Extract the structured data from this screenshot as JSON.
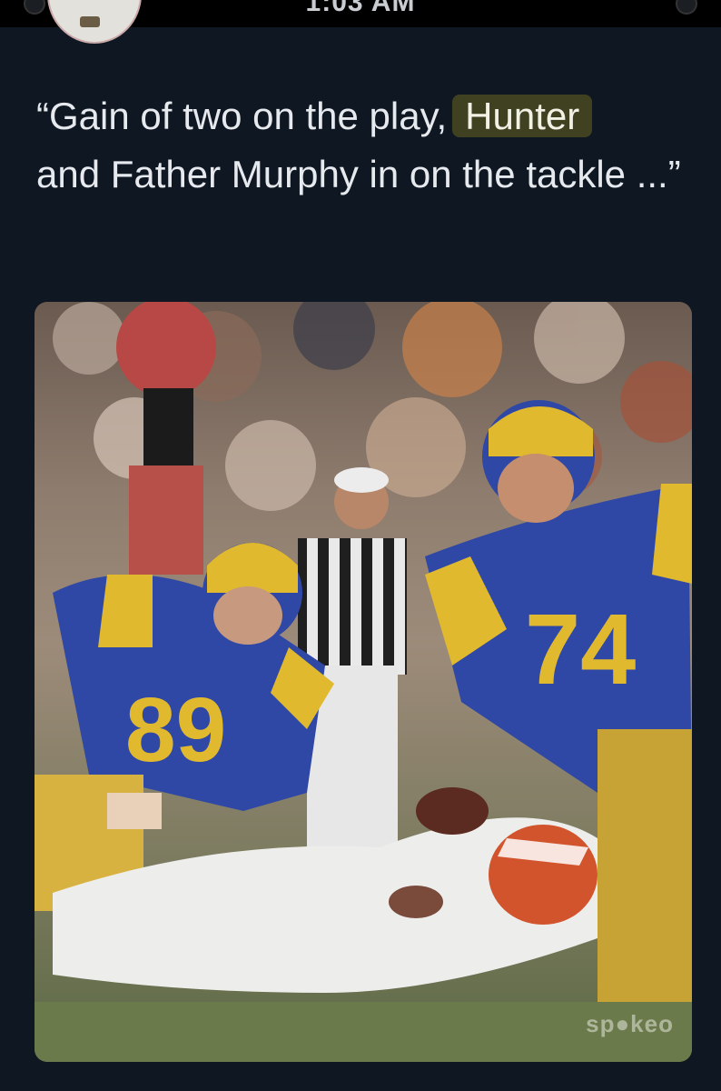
{
  "status_bar": {
    "time": "1:03 AM"
  },
  "tweet": {
    "text_before": "“Gain of two on the play,",
    "highlighted_word": "Hunter",
    "text_after": "and Father Murphy in on the tackle ...”"
  },
  "photo": {
    "jersey_numbers": [
      "89",
      "74",
      "89",
      "74"
    ],
    "watermark": "sp●keo",
    "colors": {
      "rams_blue": "#2f48a6",
      "rams_gold": "#e1b92e",
      "browns_orange": "#d2542c",
      "field": "#6b7a4a"
    }
  }
}
